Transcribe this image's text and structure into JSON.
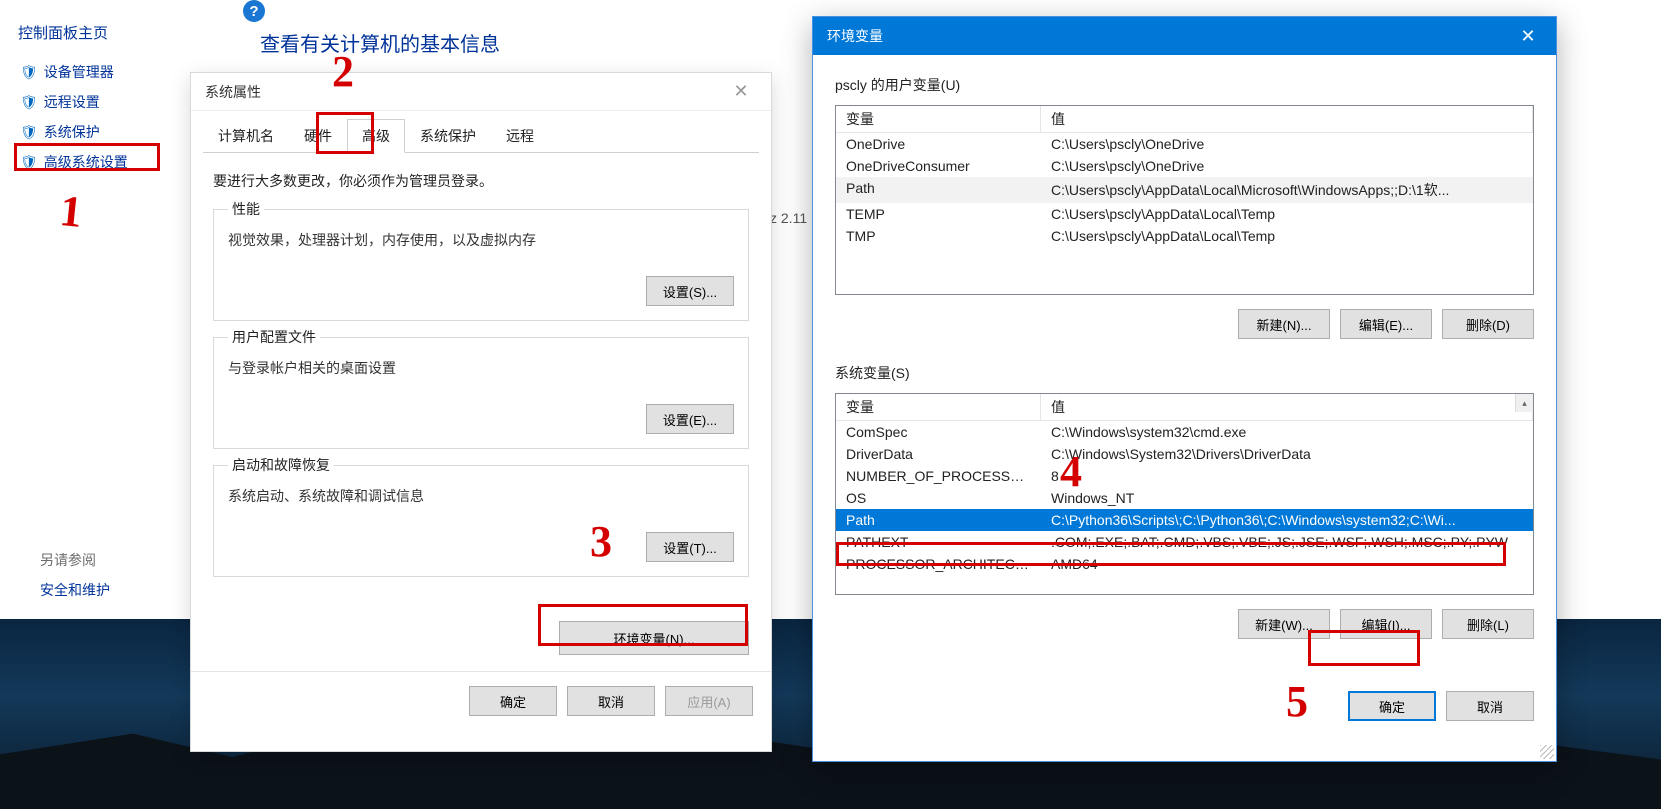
{
  "cp": {
    "title": "控制面板主页",
    "links": [
      "设备管理器",
      "远程设置",
      "系统保护",
      "高级系统设置"
    ],
    "main_heading": "查看有关计算机的基本信息",
    "also_label": "另请参阅",
    "also_link": "安全和维护"
  },
  "sysprop": {
    "title": "系统属性",
    "tabs": {
      "computer_name": "计算机名",
      "hardware": "硬件",
      "advanced": "高级",
      "protection": "系统保护",
      "remote": "远程"
    },
    "hint": "要进行大多数更改，你必须作为管理员登录。",
    "perf": {
      "title": "性能",
      "desc": "视觉效果，处理器计划，内存使用，以及虚拟内存",
      "button": "设置(S)..."
    },
    "profile": {
      "title": "用户配置文件",
      "desc": "与登录帐户相关的桌面设置",
      "button": "设置(E)..."
    },
    "startup": {
      "title": "启动和故障恢复",
      "desc": "系统启动、系统故障和调试信息",
      "button": "设置(T)..."
    },
    "env_button": "环境变量(N)...",
    "ok": "确定",
    "cancel": "取消",
    "apply": "应用(A)"
  },
  "env": {
    "title": "环境变量",
    "user_label": "pscly 的用户变量(U)",
    "sys_label": "系统变量(S)",
    "header_var": "变量",
    "header_val": "值",
    "user_vars": [
      {
        "name": "OneDrive",
        "value": "C:\\Users\\pscly\\OneDrive"
      },
      {
        "name": "OneDriveConsumer",
        "value": "C:\\Users\\pscly\\OneDrive"
      },
      {
        "name": "Path",
        "value": "C:\\Users\\pscly\\AppData\\Local\\Microsoft\\WindowsApps;;D:\\1软..."
      },
      {
        "name": "TEMP",
        "value": "C:\\Users\\pscly\\AppData\\Local\\Temp"
      },
      {
        "name": "TMP",
        "value": "C:\\Users\\pscly\\AppData\\Local\\Temp"
      }
    ],
    "sys_vars": [
      {
        "name": "ComSpec",
        "value": "C:\\Windows\\system32\\cmd.exe"
      },
      {
        "name": "DriverData",
        "value": "C:\\Windows\\System32\\Drivers\\DriverData"
      },
      {
        "name": "NUMBER_OF_PROCESSORS",
        "value": "8"
      },
      {
        "name": "OS",
        "value": "Windows_NT"
      },
      {
        "name": "Path",
        "value": "C:\\Python36\\Scripts\\;C:\\Python36\\;C:\\Windows\\system32;C:\\Wi..."
      },
      {
        "name": "PATHEXT",
        "value": ".COM;.EXE;.BAT;.CMD;.VBS;.VBE;.JS;.JSE;.WSF;.WSH;.MSC;.PY;.PYW"
      },
      {
        "name": "PROCESSOR_ARCHITECTURE",
        "value": "AMD64"
      }
    ],
    "buttons": {
      "new_user": "新建(N)...",
      "edit_user": "编辑(E)...",
      "del_user": "删除(D)",
      "new_sys": "新建(W)...",
      "edit_sys": "编辑(I)...",
      "del_sys": "删除(L)",
      "ok": "确定",
      "cancel": "取消"
    }
  },
  "bg_extra": "z  2.11",
  "annotations": [
    "1",
    "2",
    "3",
    "4",
    "5"
  ]
}
